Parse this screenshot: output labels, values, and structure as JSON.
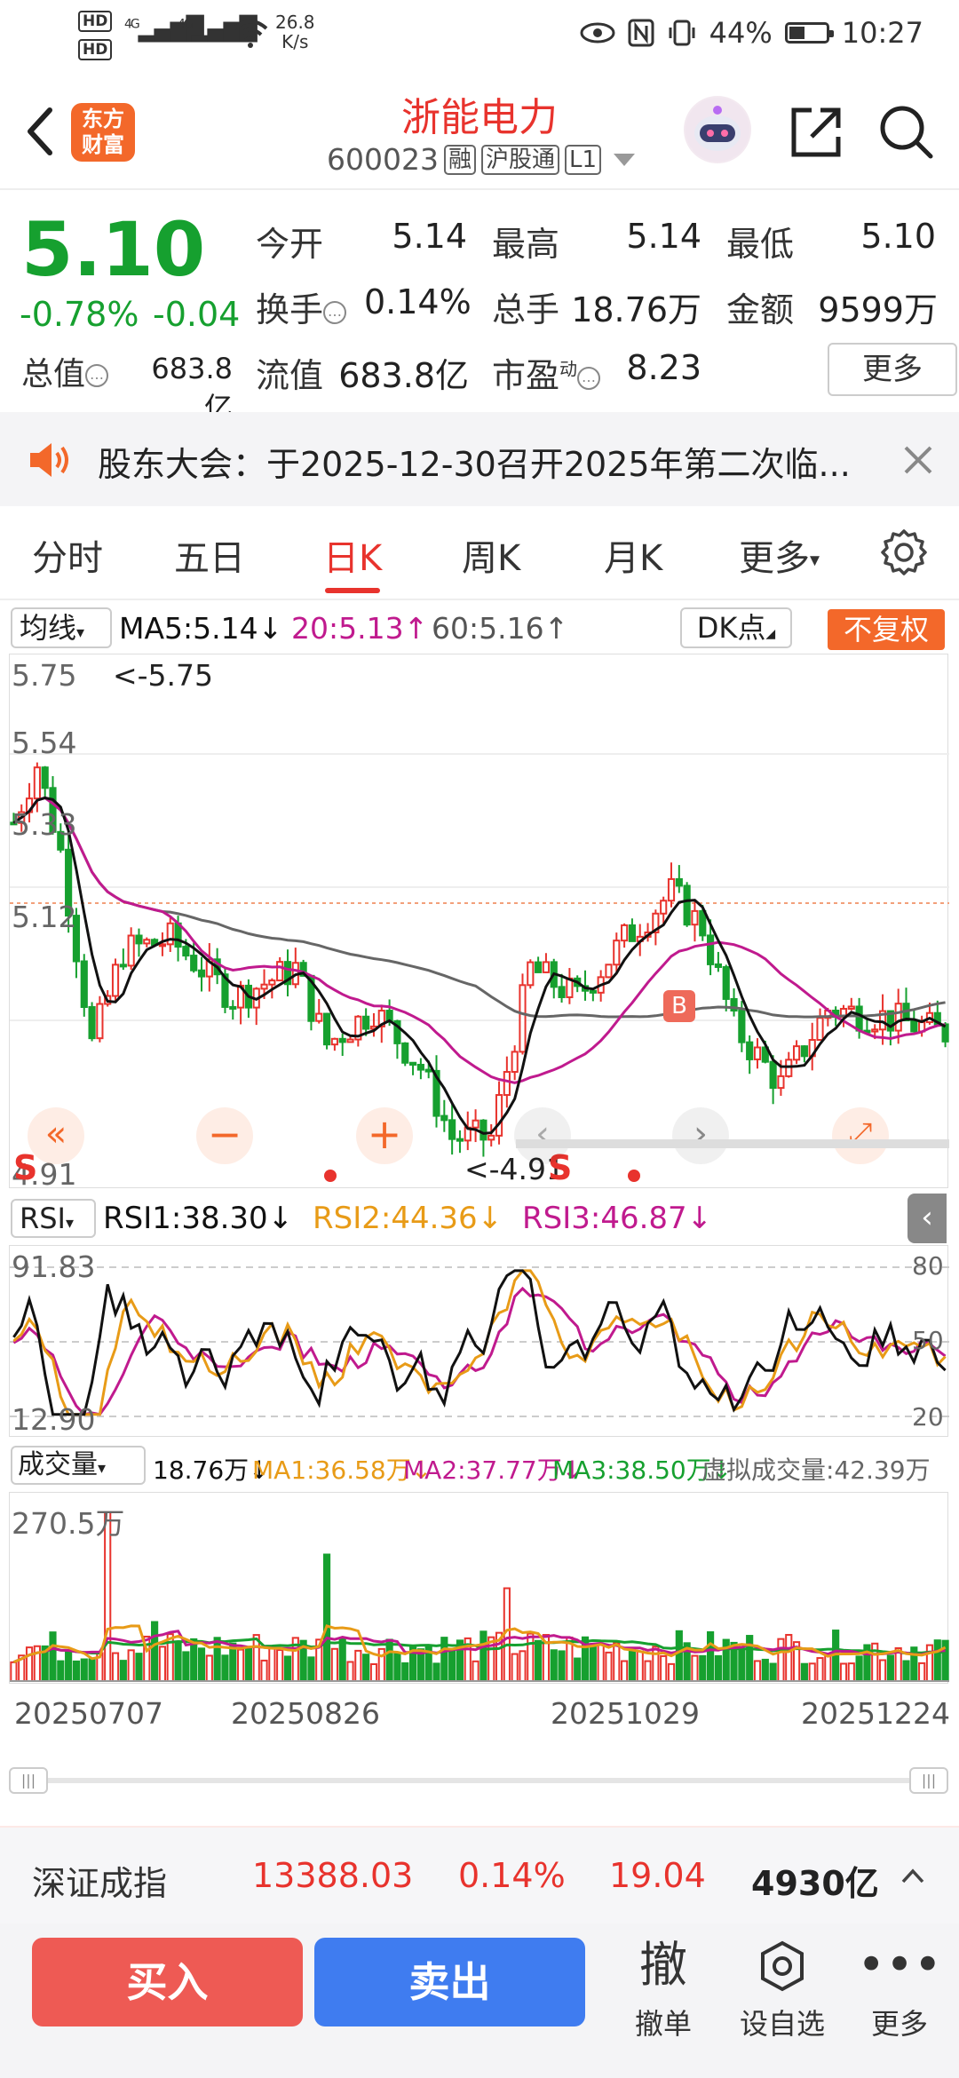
{
  "status_bar": {
    "hd1": "HD",
    "hd2": "HD",
    "net1": "4G",
    "net2": "4G",
    "speed_value": "26.8",
    "speed_unit": "K/s",
    "battery": "44%",
    "battery_level": 0.44,
    "time": "10:27"
  },
  "header": {
    "logo_line1": "东方",
    "logo_line2": "财富",
    "title": "浙能电力",
    "code": "600023",
    "tag1": "融",
    "tag2": "沪股通",
    "tag3": "L1"
  },
  "quote": {
    "price": "5.10",
    "change_pct": "-0.78%",
    "change": "-0.04",
    "open_label": "今开",
    "open": "5.14",
    "high_label": "最高",
    "high": "5.14",
    "low_label": "最低",
    "low": "5.10",
    "turnover_label": "换手",
    "turnover": "0.14%",
    "volume_label": "总手",
    "volume": "18.76万",
    "amount_label": "金额",
    "amount": "9599万",
    "mktcap_label": "总值",
    "mktcap": "683.8亿",
    "float_label": "流值",
    "float_cap": "683.8亿",
    "pe_label": "市盈",
    "pe_sup": "动",
    "pe": "8.23",
    "more": "更多"
  },
  "notice": {
    "text": "股东大会：于2025-12-30召开2025年第二次临..."
  },
  "tabs": [
    "分时",
    "五日",
    "日K",
    "周K",
    "月K",
    "更多"
  ],
  "ma_bar": {
    "selector": "均线",
    "ma5": "MA5:5.14",
    "ma20": "20:5.13",
    "ma60": "60:5.16",
    "dk": "DK点",
    "fuquan": "不复权"
  },
  "kchart": {
    "y_labels": [
      "5.75",
      "5.54",
      "5.33",
      "5.12",
      "4.91"
    ],
    "high_mark": "<-5.75",
    "low_mark": "<-4.91",
    "b_marker": "B",
    "s_marker": "S",
    "s_marker2": "S"
  },
  "rsi_bar": {
    "selector": "RSI",
    "rsi1": "RSI1:38.30",
    "rsi2": "RSI2:44.36",
    "rsi3": "RSI3:46.87"
  },
  "rsi_chart": {
    "y_left_top": "91.83",
    "y_left_bottom": "12.90",
    "y_right": [
      "80",
      "50",
      "20"
    ]
  },
  "vol_bar": {
    "selector": "成交量",
    "vol": "18.76万",
    "ma1": "MA1:36.58万",
    "ma2": "MA2:37.77万",
    "ma3": "MA3:38.50万",
    "virtual": "虚拟成交量:42.39万"
  },
  "vol_chart": {
    "y_top": "270.5万"
  },
  "dates": [
    "20250707",
    "20250826",
    "20251029",
    "20251224"
  ],
  "index_bar": {
    "name": "深证成指",
    "value": "13388.03",
    "pct": "0.14%",
    "change": "19.04",
    "amount": "4930亿"
  },
  "toolbar": {
    "buy": "买入",
    "sell": "卖出",
    "cancel_glyph": "撤",
    "cancel": "撤单",
    "watch": "设自选",
    "more": "更多"
  },
  "colors": {
    "up": "#e8332d",
    "down": "#16a02f",
    "ma5": "#111111",
    "ma20": "#c01a8e",
    "ma60": "#666666",
    "rsi2": "#e89b17",
    "brand": "#f3682a"
  }
}
